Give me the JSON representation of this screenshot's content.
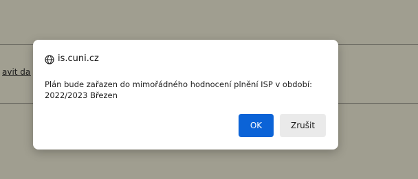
{
  "background_page": {
    "link_text": "avit dal"
  },
  "dialog": {
    "origin": "is.cuni.cz",
    "message_line1": "Plán bude zařazen do mimořádného hodnocení plnění ISP v období:",
    "message_line2": "2022/2023 Březen",
    "ok_label": "OK",
    "cancel_label": "Zrušit",
    "origin_icon": "globe-icon"
  },
  "colors": {
    "overlay": "#a09e90",
    "primary_button": "#0b63d7",
    "secondary_button": "#eaeaea",
    "dialog_background": "#ffffff"
  }
}
